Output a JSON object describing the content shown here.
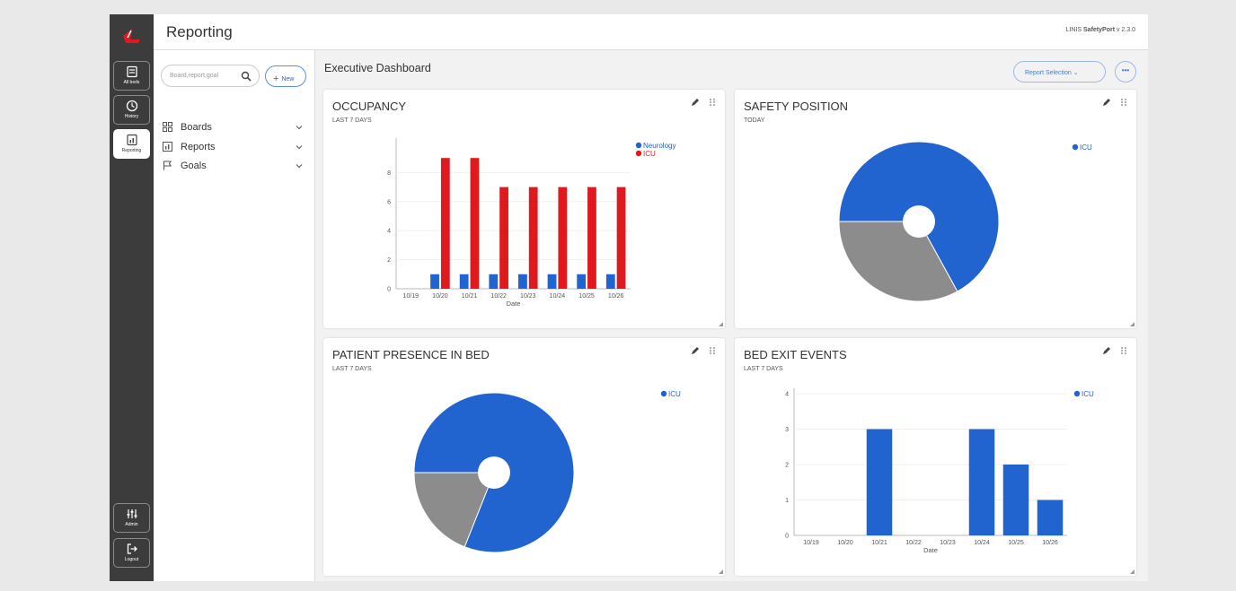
{
  "header": {
    "title": "Reporting",
    "version_prefix": "LINIS ",
    "version_brand": "SafetyPort",
    "version_num": " v 2.3.0"
  },
  "rail": {
    "items": [
      {
        "label": "All beds",
        "icon": "bed-list-icon"
      },
      {
        "label": "History",
        "icon": "clock-icon"
      },
      {
        "label": "Reporting",
        "icon": "chart-icon"
      }
    ],
    "bottom": [
      {
        "label": "Admin",
        "icon": "sliders-icon"
      },
      {
        "label": "Logout",
        "icon": "logout-icon"
      }
    ]
  },
  "nav": {
    "search_placeholder": "Board,report,goal",
    "new_label": "New",
    "items": [
      {
        "label": "Boards",
        "icon": "boards-icon"
      },
      {
        "label": "Reports",
        "icon": "reports-icon"
      },
      {
        "label": "Goals",
        "icon": "flag-icon"
      }
    ]
  },
  "main": {
    "title": "Executive Dashboard",
    "report_selection": "Report Selection",
    "more": "•••"
  },
  "colors": {
    "blue": "#2163cf",
    "red": "#e0191f",
    "gray": "#8c8c8c",
    "accent": "#4b7bd0"
  },
  "chart_data": [
    {
      "type": "bar",
      "title": "OCCUPANCY",
      "subtitle": "LAST 7 DAYS",
      "categories": [
        "10/19",
        "10/20",
        "10/21",
        "10/22",
        "10/23",
        "10/24",
        "10/25",
        "10/26"
      ],
      "series": [
        {
          "name": "Neurology",
          "color": "#2163cf",
          "values": [
            0,
            1,
            1,
            1,
            1,
            1,
            1,
            1
          ]
        },
        {
          "name": "ICU",
          "color": "#e0191f",
          "values": [
            0,
            9,
            9,
            7,
            7,
            7,
            7,
            7
          ]
        }
      ],
      "xlabel": "Date",
      "ylim": [
        0,
        10
      ],
      "yticks": [
        0,
        2,
        4,
        6,
        8
      ],
      "legend": "top-right"
    },
    {
      "type": "pie",
      "title": "SAFETY POSITION",
      "subtitle": "TODAY",
      "slices": [
        {
          "value": 67,
          "color": "#2163cf"
        },
        {
          "value": 33,
          "color": "#8c8c8c"
        }
      ],
      "legend_items": [
        {
          "name": "ICU",
          "color": "#2163cf"
        }
      ],
      "legend": "top-right"
    },
    {
      "type": "pie",
      "title": "PATIENT PRESENCE IN BED",
      "subtitle": "LAST 7 DAYS",
      "slices": [
        {
          "value": 81,
          "color": "#2163cf"
        },
        {
          "value": 19,
          "color": "#8c8c8c"
        }
      ],
      "legend_items": [
        {
          "name": "ICU",
          "color": "#2163cf"
        }
      ],
      "legend": "top-right"
    },
    {
      "type": "bar",
      "title": "BED EXIT EVENTS",
      "subtitle": "LAST 7 DAYS",
      "categories": [
        "10/19",
        "10/20",
        "10/21",
        "10/22",
        "10/23",
        "10/24",
        "10/25",
        "10/26"
      ],
      "series": [
        {
          "name": "ICU",
          "color": "#2163cf",
          "values": [
            0,
            0,
            3,
            0,
            0,
            3,
            2,
            1
          ]
        }
      ],
      "xlabel": "Date",
      "ylim": [
        0,
        4
      ],
      "yticks": [
        0,
        1,
        2,
        3,
        4
      ],
      "legend": "top-right"
    }
  ]
}
